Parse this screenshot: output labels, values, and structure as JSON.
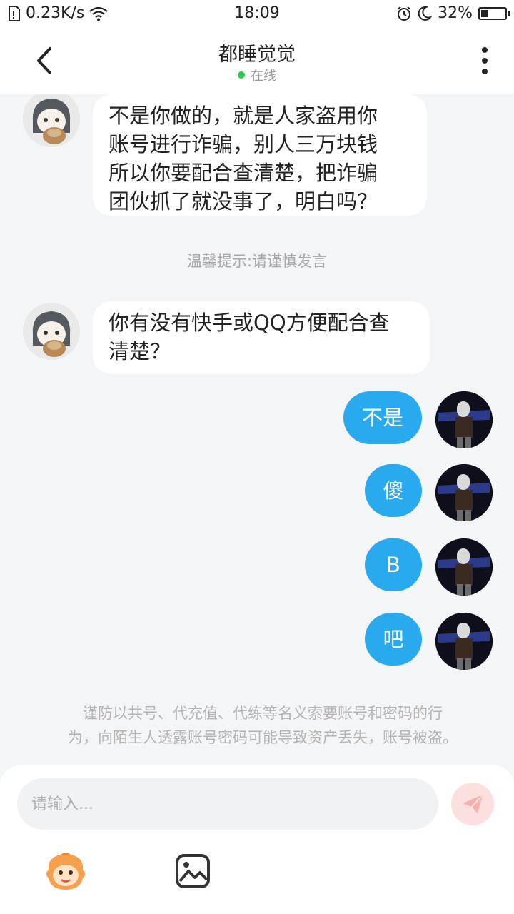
{
  "status_bar": {
    "network_speed": "0.23K/s",
    "time": "18:09",
    "battery_percent": "32%",
    "battery_level": 0.32,
    "icons": [
      "sim-icon",
      "wifi-icon",
      "alarm-icon",
      "moon-icon",
      "battery-icon"
    ]
  },
  "header": {
    "title": "都睡觉觉",
    "status": "在线",
    "status_color": "#2dc84d",
    "icons": [
      "back-arrow-icon",
      "more-vertical-icon"
    ]
  },
  "messages": [
    {
      "side": "left",
      "lines": [
        "不是你做的，就是人家盗用你",
        "账号进行诈骗，别人三万块钱",
        "所以你要配合查清楚，把诈骗",
        "团伙抓了就没事了，明白吗？"
      ]
    },
    {
      "side": "left",
      "lines": [
        "你有没有快手或QQ方便配合查",
        "清楚？"
      ]
    },
    {
      "side": "right",
      "text": "不是"
    },
    {
      "side": "right",
      "text": "傻"
    },
    {
      "side": "right",
      "text": "B"
    },
    {
      "side": "right",
      "text": "吧"
    }
  ],
  "tip": "温馨提示:请谨慎发言",
  "warning": {
    "lines": [
      "谨防以共号、代充值、代练等名义索要账号和密码的行",
      "为，向陌生人透露账号密码可能导致资产丢失，账号被盗。"
    ]
  },
  "input": {
    "placeholder": "请输入..."
  },
  "colors": {
    "accent_blue": "#29a9ee",
    "send_button_bg": "#fbe0df",
    "send_icon": "#f4b1ae"
  },
  "toolbar_icons": [
    "emoji-icon",
    "image-icon",
    "send-icon"
  ]
}
